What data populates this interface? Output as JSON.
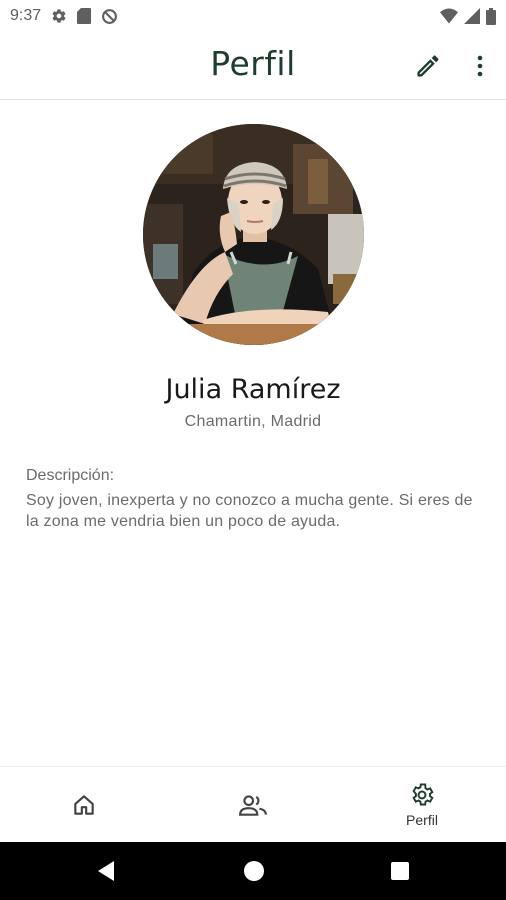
{
  "status_bar": {
    "time": "9:37",
    "left_icons": [
      "gear-icon",
      "sd-card-icon",
      "do-not-disturb-icon"
    ],
    "right_icons": [
      "wifi-icon",
      "signal-icon",
      "battery-icon"
    ]
  },
  "app_bar": {
    "title": "Perfil",
    "actions": [
      "edit-icon",
      "more-vert-icon"
    ],
    "title_color": "#1d3e2e"
  },
  "profile": {
    "name": "Julia Ramírez",
    "location": "Chamartin, Madrid",
    "description_label": "Descripción:",
    "description": "Soy joven, inexperta y no conozco a mucha gente. Si eres de la zona me vendria bien un poco de ayuda."
  },
  "bottom_nav": {
    "items": [
      {
        "icon": "home-icon",
        "label": ""
      },
      {
        "icon": "people-icon",
        "label": ""
      },
      {
        "icon": "settings-icon",
        "label": "Perfil"
      }
    ],
    "selected": "Perfil"
  },
  "system_nav": [
    "back-icon",
    "home-circle-icon",
    "recents-icon"
  ]
}
